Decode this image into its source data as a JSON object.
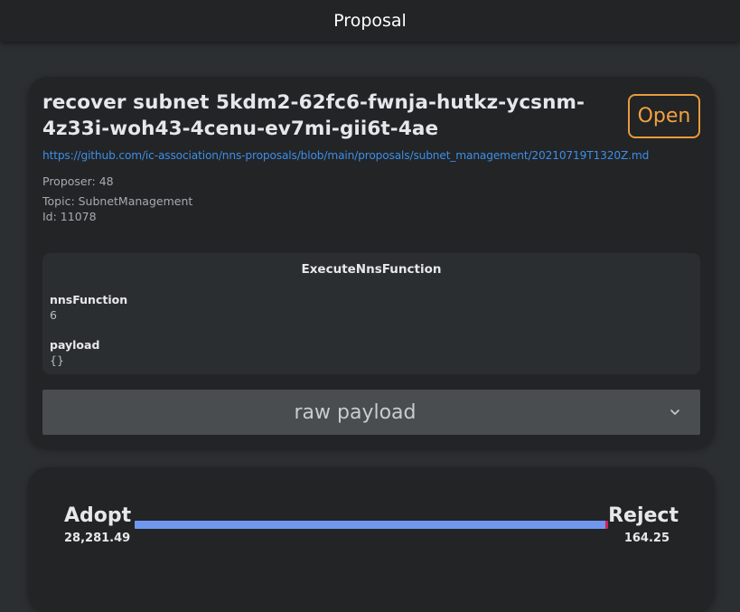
{
  "header": {
    "title": "Proposal"
  },
  "proposal": {
    "title": "recover subnet 5kdm2-62fc6-fwnja-hutkz-ycsnm-4z33i-woh43-4cenu-ev7mi-gii6t-4ae",
    "status": "Open",
    "link": "https://github.com/ic-association/nns-proposals/blob/main/proposals/subnet_management/20210719T1320Z.md",
    "proposer": "Proposer: 48",
    "topic": "Topic: SubnetManagement",
    "id": "Id: 11078"
  },
  "payload_panel": {
    "title": "ExecuteNnsFunction",
    "fields": [
      {
        "label": "nnsFunction",
        "value": "6"
      },
      {
        "label": "payload",
        "value": "{}"
      }
    ]
  },
  "raw_payload": {
    "label": "raw payload",
    "icon": "chevron-down-icon"
  },
  "votes": {
    "adopt_label": "Adopt",
    "adopt_value": "28,281.49",
    "reject_label": "Reject",
    "reject_value": "164.25",
    "adopt_fraction": 0.9942,
    "colors": {
      "adopt": "#7097ef",
      "reject": "#d1245b"
    }
  }
}
